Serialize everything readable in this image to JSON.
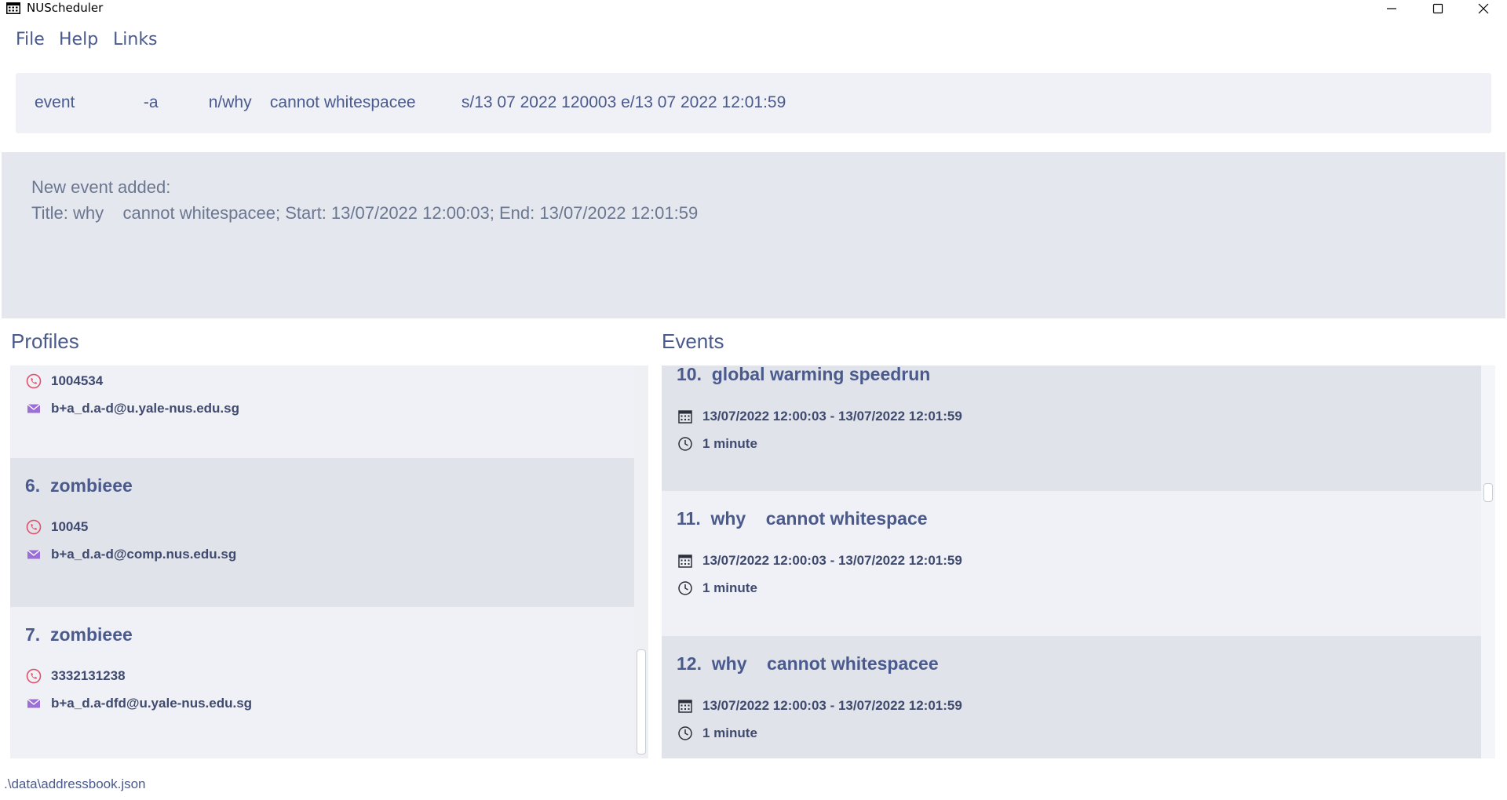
{
  "window": {
    "title": "NUScheduler",
    "icon": "calendar-icon"
  },
  "menu": {
    "file": "File",
    "help": "Help",
    "links": "Links"
  },
  "command_box": {
    "value": "event               -a           n/why    cannot whitespacee          s/13 07 2022 120003 e/13 07 2022 12:01:59"
  },
  "result": {
    "line1": "New event added:",
    "line2": "Title: why    cannot whitespacee; Start: 13/07/2022 12:00:03; End: 13/07/2022 12:01:59"
  },
  "profiles": {
    "title": "Profiles",
    "items": [
      {
        "name": "",
        "phone": "1004534",
        "email": "b+a_d.a-d@u.yale-nus.edu.sg"
      },
      {
        "name": "6.  zombieee",
        "phone": "10045",
        "email": "b+a_d.a-d@comp.nus.edu.sg"
      },
      {
        "name": "7.  zombieee",
        "phone": "3332131238",
        "email": "b+a_d.a-dfd@u.yale-nus.edu.sg"
      }
    ]
  },
  "events": {
    "title": "Events",
    "items": [
      {
        "name": "10.  global warming speedrun",
        "time": "13/07/2022 12:00:03 - 13/07/2022 12:01:59",
        "duration": "1 minute"
      },
      {
        "name": "11.  why    cannot whitespace",
        "time": "13/07/2022 12:00:03 - 13/07/2022 12:01:59",
        "duration": "1 minute"
      },
      {
        "name": "12.  why    cannot whitespacee",
        "time": "13/07/2022 12:00:03 - 13/07/2022 12:01:59",
        "duration": "1 minute"
      }
    ]
  },
  "status_bar": {
    "path": ".\\data\\addressbook.json"
  },
  "colors": {
    "phone_icon": "#e0506a",
    "email_icon": "#9b6fd6",
    "text": "#4a5a8c"
  }
}
